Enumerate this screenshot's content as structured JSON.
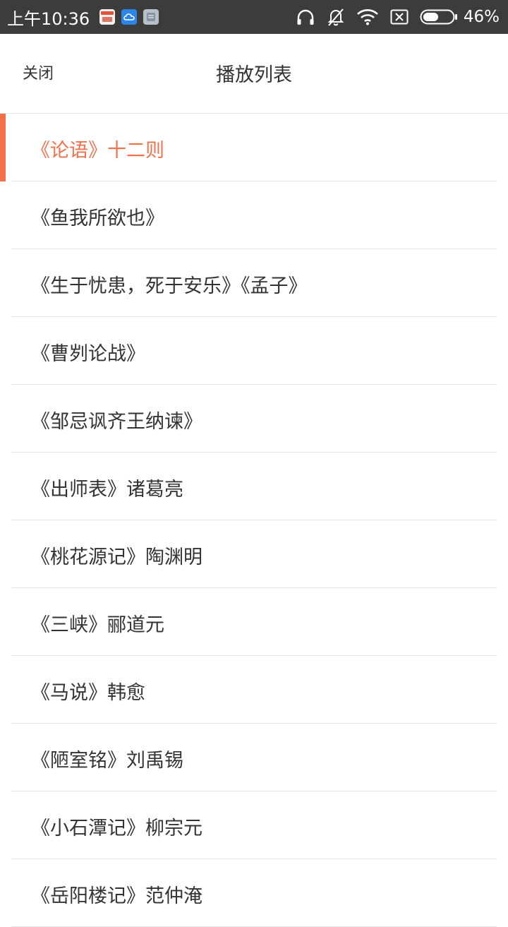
{
  "status_bar": {
    "time": "上午10:36",
    "battery": "46%",
    "icons": [
      "calendar-app-icon",
      "cloud-app-icon",
      "notes-app-icon",
      "headphones-icon",
      "mute-bell-icon",
      "wifi-icon",
      "no-sim-icon",
      "battery-icon"
    ]
  },
  "header": {
    "close_label": "关闭",
    "title": "播放列表"
  },
  "playlist": {
    "active_index": 0,
    "accent_color": "#f0714a",
    "items": [
      "《论语》十二则",
      "《鱼我所欲也》",
      "《生于忧患，死于安乐》《孟子》",
      "《曹刿论战》",
      "《邹忌讽齐王纳谏》",
      "《出师表》诸葛亮",
      "《桃花源记》陶渊明",
      "《三峡》郦道元",
      "《马说》韩愈",
      "《陋室铭》刘禹锡",
      "《小石潭记》柳宗元",
      "《岳阳楼记》范仲淹"
    ]
  }
}
